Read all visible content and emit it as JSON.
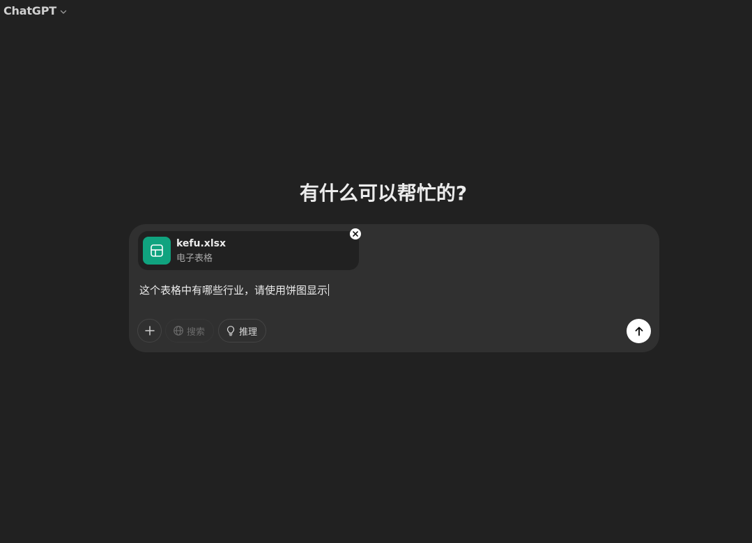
{
  "header": {
    "model_name": "ChatGPT"
  },
  "main": {
    "headline": "有什么可以帮忙的?"
  },
  "composer": {
    "attachment": {
      "file_name": "kefu.xlsx",
      "file_type": "电子表格"
    },
    "prompt_text": "这个表格中有哪些行业，请使用饼图显示",
    "tools": {
      "search_label": "搜索",
      "reason_label": "推理"
    }
  },
  "colors": {
    "background": "#212121",
    "composer": "#303030",
    "file_icon": "#10a37f"
  }
}
